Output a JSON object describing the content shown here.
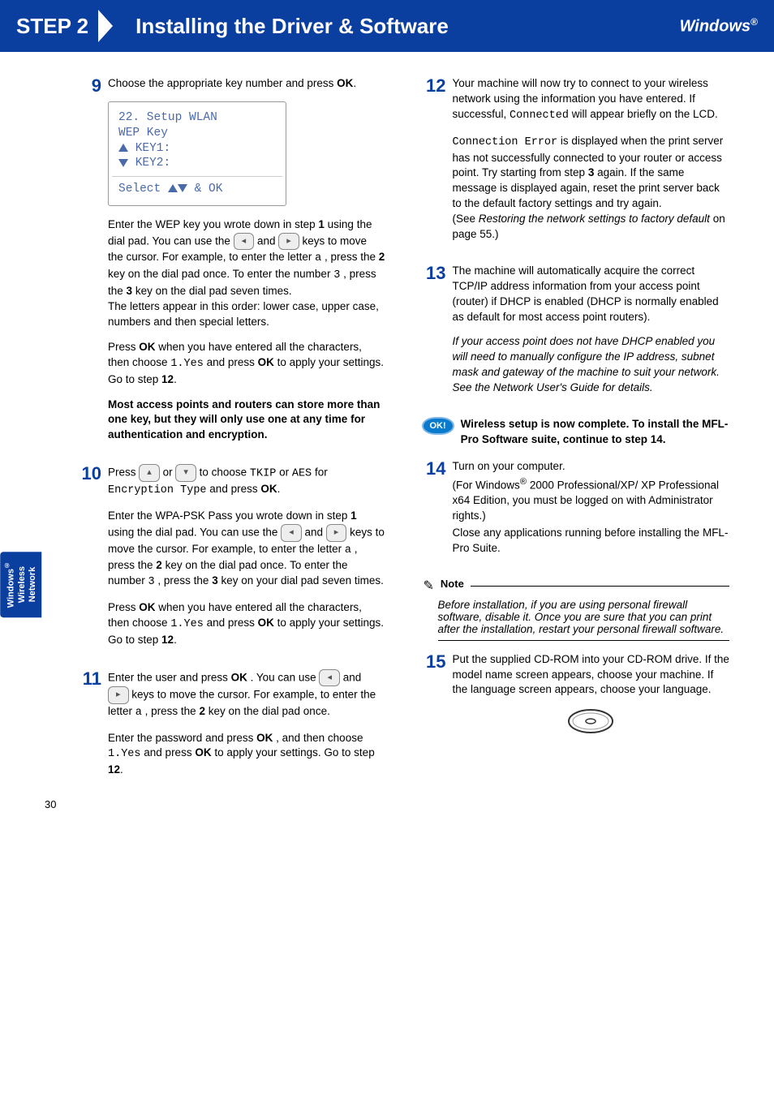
{
  "header": {
    "step_label": "STEP 2",
    "title": "Installing the Driver & Software",
    "platform": "Windows",
    "platform_sup": "®"
  },
  "side_tab": {
    "line1": "Windows",
    "sup": "®",
    "line2": "Wireless",
    "line3": "Network"
  },
  "page_number": "30",
  "lcd": {
    "line1": "22. Setup WLAN",
    "line2": " WEP Key",
    "line3": "    KEY1:",
    "line4": "    KEY2:",
    "bottom": "Select    & OK"
  },
  "steps": {
    "s9": {
      "num": "9",
      "p1a": "Choose the appropriate key number and press ",
      "p1b": "OK",
      "p1c": ".",
      "p2a": "Enter the WEP key you wrote down in step ",
      "p2b": "1",
      "p2c": " using the dial pad. You can use the ",
      "p2d": " and ",
      "p2e": " keys to move the cursor. For example, to enter the letter ",
      "p2f": "a",
      "p2g": ", press the ",
      "p2h": "2",
      "p2i": " key on the dial pad once. To enter the number ",
      "p2j": "3",
      "p2k": ", press the ",
      "p2l": "3",
      "p2m": " key on the dial pad seven times.",
      "p2n": "The letters appear in this order: lower case, upper case, numbers and then special letters.",
      "p3a": "Press ",
      "p3b": "OK",
      "p3c": " when you have entered all the characters, then choose ",
      "p3d": "1.Yes",
      "p3e": " and press ",
      "p3f": "OK",
      "p3g": " to apply your settings. Go to step ",
      "p3h": "12",
      "p3i": ".",
      "p4": "Most access points and routers can store more than one key, but they will only use one at any time for authentication and encryption."
    },
    "s10": {
      "num": "10",
      "p1a": "Press ",
      "p1b": " or ",
      "p1c": " to choose ",
      "p1d": "TKIP",
      "p1e": " or ",
      "p1f": "AES",
      "p1g": " for ",
      "p1h": "Encryption Type",
      "p1i": " and press ",
      "p1j": "OK",
      "p1k": ".",
      "p2a": "Enter the WPA-PSK Pass you wrote down in step ",
      "p2b": "1",
      "p2c": " using the dial pad. You can use the ",
      "p2d": " and ",
      "p2e": " keys to move the cursor. For example, to enter the letter ",
      "p2f": "a",
      "p2g": ", press the ",
      "p2h": "2",
      "p2i": " key on the dial pad once. To enter the number ",
      "p2j": "3",
      "p2k": ", press the ",
      "p2l": "3",
      "p2m": " key on your dial pad seven times.",
      "p3a": "Press ",
      "p3b": "OK",
      "p3c": " when you have entered all the characters, then choose ",
      "p3d": "1.Yes",
      "p3e": " and press ",
      "p3f": "OK",
      "p3g": " to apply your settings. Go to step ",
      "p3h": "12",
      "p3i": "."
    },
    "s11": {
      "num": "11",
      "p1a": "Enter the user and press ",
      "p1b": "OK",
      "p1c": ". You can use ",
      "p1d": " and ",
      "p1e": " keys to move the cursor. For example, to enter the letter ",
      "p1f": "a",
      "p1g": ", press the ",
      "p1h": "2",
      "p1i": " key on the dial pad once.",
      "p2a": "Enter the password and press ",
      "p2b": "OK",
      "p2c": ", and then choose ",
      "p2d": "1.Yes",
      "p2e": " and press ",
      "p2f": "OK",
      "p2g": " to apply your settings. Go to step ",
      "p2h": "12",
      "p2i": "."
    },
    "s12": {
      "num": "12",
      "p1a": "Your machine will now try to connect to your wireless network using the information you have entered. If successful, ",
      "p1b": "Connected",
      "p1c": " will appear briefly on the LCD.",
      "p2a": "Connection Error",
      "p2b": " is displayed when the print server has not successfully connected to your router or access point. Try starting from step ",
      "p2c": "3",
      "p2d": " again. If the same message is displayed again, reset the print server back to the default factory settings and try again.",
      "p2e": "(See ",
      "p2f": "Restoring the network settings to factory default",
      "p2g": " on page 55.)"
    },
    "s13": {
      "num": "13",
      "p1": "The machine will automatically acquire the correct TCP/IP address information from your access point (router) if DHCP is enabled (DHCP is normally enabled as default for most access point routers).",
      "p2": "If your access point does not have DHCP enabled you will need to manually configure the IP address, subnet mask and gateway of the machine to suit your network. See the Network User's Guide for details."
    },
    "ok_callout": "Wireless setup is now complete. To install the MFL-Pro Software suite, continue to step 14.",
    "s14": {
      "num": "14",
      "p1": "Turn on your computer.",
      "p2a": "(For Windows",
      "p2sup": "®",
      "p2b": " 2000 Professional/XP/ XP Professional x64 Edition, you must be logged on with Administrator rights.)",
      "p3": "Close any applications running before installing the MFL-Pro Suite."
    },
    "note": {
      "label": "Note",
      "body": "Before installation, if you are using personal firewall software, disable it. Once you are sure that you can print after the installation, restart your personal firewall software."
    },
    "s15": {
      "num": "15",
      "p1": "Put the supplied CD-ROM into your CD-ROM drive. If the model name screen appears, choose your machine. If the language screen appears, choose your language."
    }
  }
}
